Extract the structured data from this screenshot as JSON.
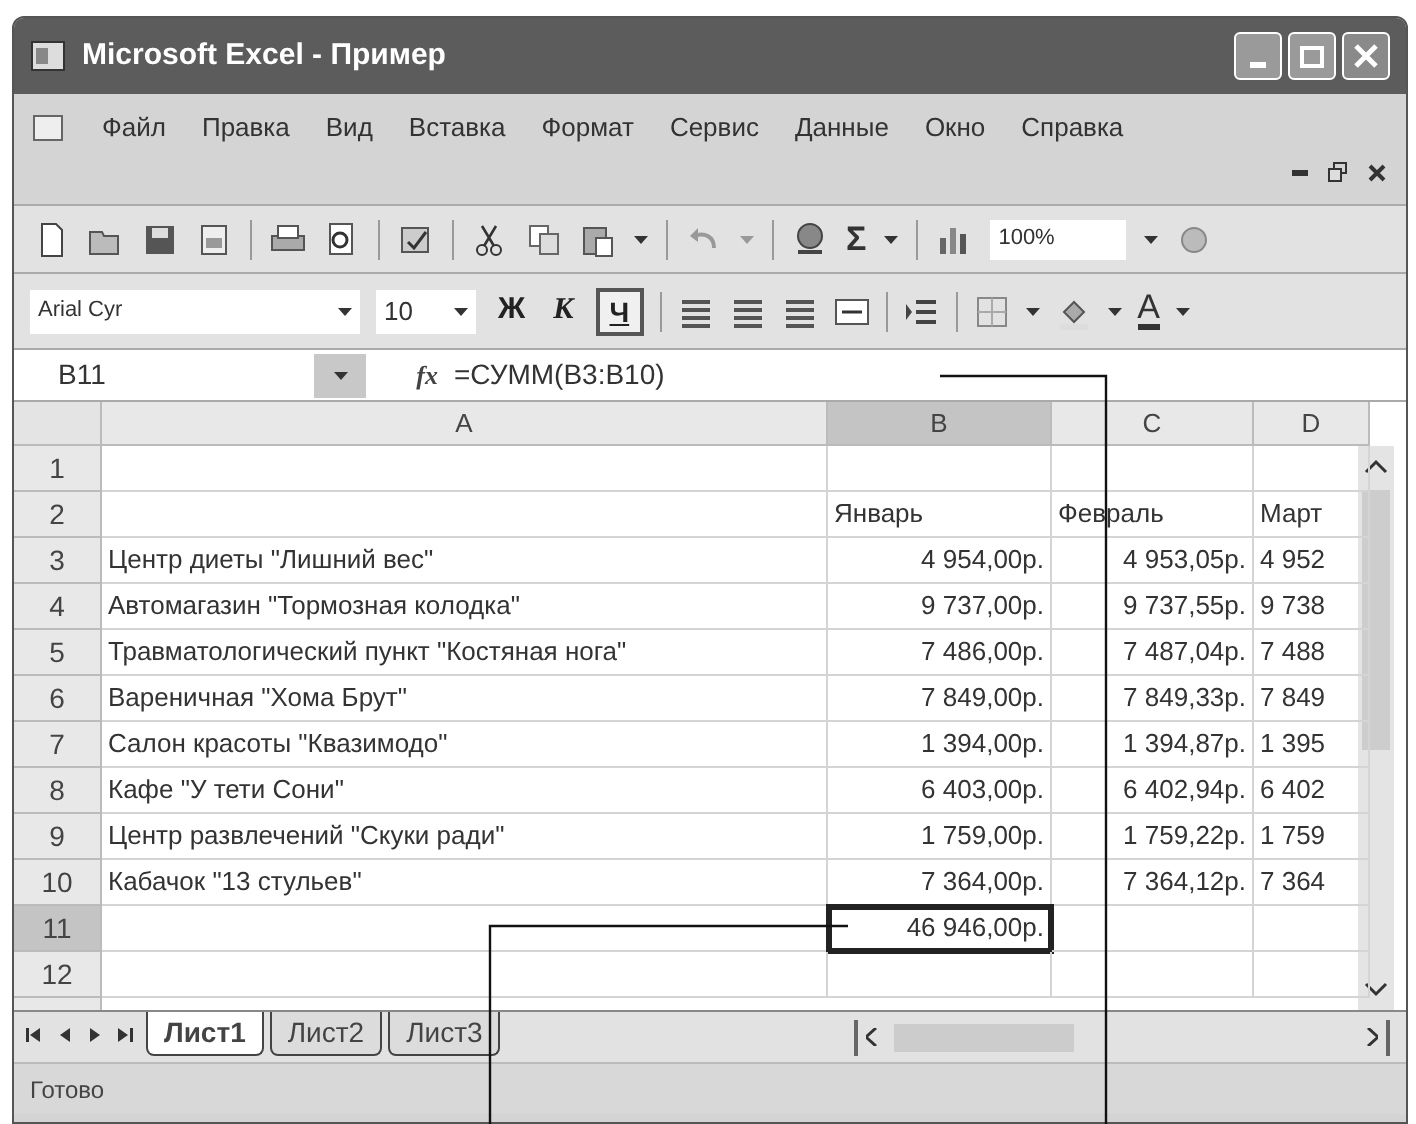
{
  "window": {
    "title": "Microsoft Excel - Пример"
  },
  "menu": [
    "Файл",
    "Правка",
    "Вид",
    "Вставка",
    "Формат",
    "Сервис",
    "Данные",
    "Окно",
    "Справка"
  ],
  "standard_toolbar": {
    "sum": "Σ",
    "zoom": "100%"
  },
  "formatting_toolbar": {
    "font": "Arial Cyr",
    "size": "10",
    "bold": "Ж",
    "italic": "К",
    "underline": "Ч",
    "underline_on": true,
    "font_color": "A"
  },
  "formula_bar": {
    "name_box": "B11",
    "fx": "fx",
    "formula": "=СУММ(B3:B10)"
  },
  "columns": [
    {
      "label": "A",
      "selected": false
    },
    {
      "label": "B",
      "selected": true
    },
    {
      "label": "C",
      "selected": false
    },
    {
      "label": "D",
      "selected": false
    }
  ],
  "rows": [
    {
      "label": "1",
      "selected": false,
      "cells": {}
    },
    {
      "label": "2",
      "selected": false,
      "cells": {
        "b": "Январь",
        "c": "Февраль",
        "d": "Март"
      }
    },
    {
      "label": "3",
      "selected": false,
      "cells": {
        "a": "Центр диеты \"Лишний вес\"",
        "b": "4 954,00р.",
        "c": "4 953,05р.",
        "d": "4 952"
      }
    },
    {
      "label": "4",
      "selected": false,
      "cells": {
        "a": "Автомагазин \"Тормозная колодка\"",
        "b": "9 737,00р.",
        "c": "9 737,55р.",
        "d": "9 738"
      }
    },
    {
      "label": "5",
      "selected": false,
      "cells": {
        "a": "Травматологический пункт \"Костяная нога\"",
        "b": "7 486,00р.",
        "c": "7 487,04р.",
        "d": "7 488"
      }
    },
    {
      "label": "6",
      "selected": false,
      "cells": {
        "a": "Вареничная \"Хома Брут\"",
        "b": "7 849,00р.",
        "c": "7 849,33р.",
        "d": "7 849"
      }
    },
    {
      "label": "7",
      "selected": false,
      "cells": {
        "a": "Салон красоты \"Квазимодо\"",
        "b": "1 394,00р.",
        "c": "1 394,87р.",
        "d": "1 395"
      }
    },
    {
      "label": "8",
      "selected": false,
      "cells": {
        "a": "Кафе \"У тети Сони\"",
        "b": "6 403,00р.",
        "c": "6 402,94р.",
        "d": "6 402"
      }
    },
    {
      "label": "9",
      "selected": false,
      "cells": {
        "a": "Центр развлечений \"Скуки ради\"",
        "b": "1 759,00р.",
        "c": "1 759,22р.",
        "d": "1 759"
      }
    },
    {
      "label": "10",
      "selected": false,
      "cells": {
        "a": "Кабачок \"13 стульев\"",
        "b": "7 364,00р.",
        "c": "7 364,12р.",
        "d": "7 364"
      }
    },
    {
      "label": "11",
      "selected": true,
      "cells": {
        "b": "46 946,00р."
      }
    },
    {
      "label": "12",
      "selected": false,
      "cells": {}
    }
  ],
  "sheet_tabs": [
    {
      "label": "Лист1",
      "selected": true
    },
    {
      "label": "Лист2",
      "selected": false
    },
    {
      "label": "Лист3",
      "selected": false
    }
  ],
  "status_bar": "Готово"
}
